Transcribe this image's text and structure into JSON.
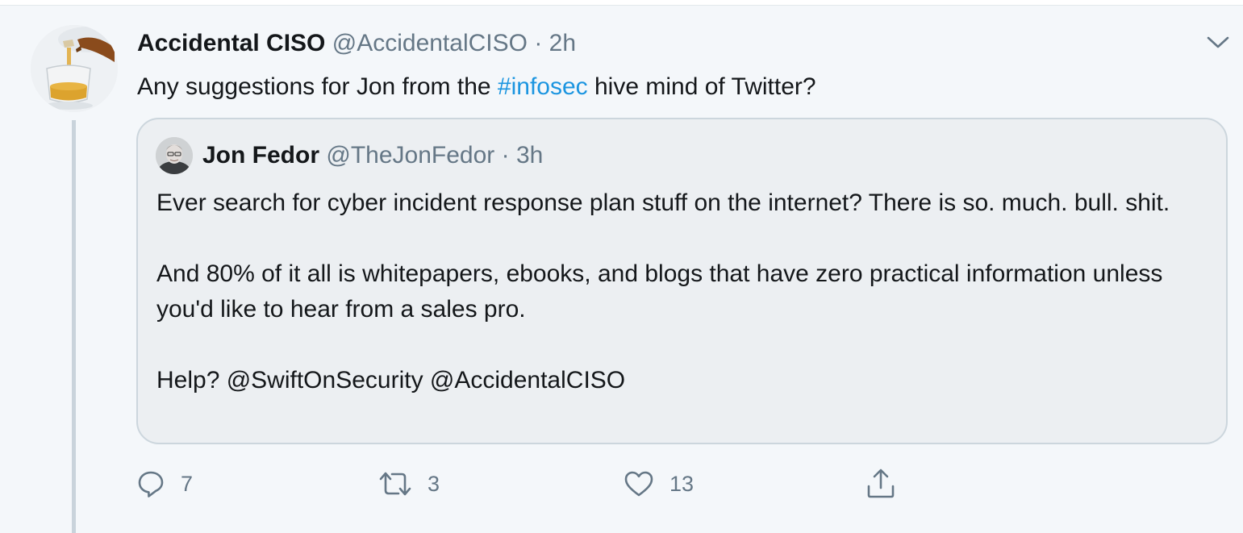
{
  "tweet": {
    "display_name": "Accidental CISO",
    "handle": "@AccidentalCISO",
    "separator": "·",
    "time": "2h",
    "text_before": "Any suggestions for Jon from the ",
    "hashtag": "#infosec",
    "text_after": " hive mind of Twitter?",
    "more_icon": "chevron-down-icon"
  },
  "quoted": {
    "display_name": "Jon Fedor",
    "handle": "@TheJonFedor",
    "separator": "·",
    "time": "3h",
    "paragraphs": [
      "Ever search for cyber incident response plan stuff on the internet? There is so. much. bull. shit.",
      "And 80% of it all is whitepapers, ebooks, and blogs that have zero practical information unless you'd like to hear from a sales pro.",
      "Help? @SwiftOnSecurity @AccidentalCISO"
    ]
  },
  "actions": {
    "reply": {
      "icon": "reply-icon",
      "count": "7"
    },
    "retweet": {
      "icon": "retweet-icon",
      "count": "3"
    },
    "like": {
      "icon": "heart-icon",
      "count": "13"
    },
    "share": {
      "icon": "share-icon"
    }
  },
  "colors": {
    "background": "#f4f7fa",
    "link": "#1b95e0",
    "secondary_text": "#657786",
    "primary_text": "#14171a",
    "thread_line": "#c9d3db"
  }
}
